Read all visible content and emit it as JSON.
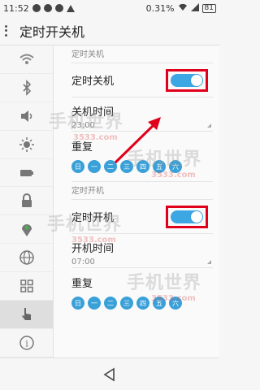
{
  "status_bar": {
    "time": "11:52",
    "battery_percent": "0.31%",
    "battery_level": "81"
  },
  "header": {
    "title": "定时开关机"
  },
  "sidebar": {
    "items": [
      {
        "icon": "wifi-icon"
      },
      {
        "icon": "bluetooth-icon"
      },
      {
        "icon": "volume-icon"
      },
      {
        "icon": "brightness-icon"
      },
      {
        "icon": "battery-icon"
      },
      {
        "icon": "lock-icon"
      },
      {
        "icon": "location-icon"
      },
      {
        "icon": "globe-icon"
      },
      {
        "icon": "apps-grid-icon"
      },
      {
        "icon": "hand-gesture-icon"
      },
      {
        "icon": "info-icon"
      }
    ],
    "active_index": 9
  },
  "shutdown": {
    "section_label": "定时关机",
    "toggle_label": "定时关机",
    "toggle_on": true,
    "time_label": "关机时间",
    "time_value": "23:00",
    "repeat_label": "重复",
    "days": [
      "日",
      "一",
      "二",
      "三",
      "四",
      "五",
      "六"
    ]
  },
  "startup": {
    "section_label": "定时开机",
    "toggle_label": "定时开机",
    "toggle_on": true,
    "time_label": "开机时间",
    "time_value": "07:00",
    "repeat_label": "重复",
    "days": [
      "日",
      "一",
      "二",
      "三",
      "四",
      "五",
      "六"
    ]
  },
  "watermark": {
    "text": "手机世界",
    "sub": "3533.com"
  },
  "colors": {
    "accent": "#3da7e4",
    "highlight": "#e0001b",
    "day": "#3aa0d8"
  }
}
